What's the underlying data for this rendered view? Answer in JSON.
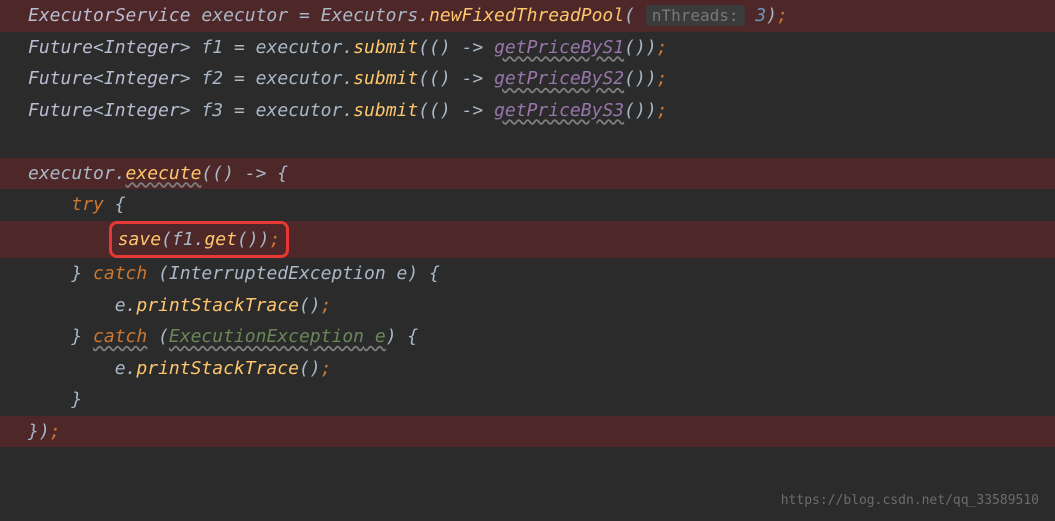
{
  "code": {
    "line1": {
      "type": "ExecutorService",
      "var": "executor",
      "eq": "=",
      "class": "Executors",
      "dot": ".",
      "method": "newFixedThreadPool",
      "open": "(",
      "hint": "nThreads:",
      "num": "3",
      "close": ")",
      "semi": ";"
    },
    "line2": {
      "type": "Future",
      "generic_open": "<",
      "generic_type": "Integer",
      "generic_close": ">",
      "var": "f1",
      "eq": "=",
      "obj": "executor",
      "dot": ".",
      "method": "submit",
      "args": "(() -> ",
      "call": "getPriceByS1",
      "parens": "()",
      "close": ")",
      "semi": ";"
    },
    "line3": {
      "type": "Future",
      "generic_open": "<",
      "generic_type": "Integer",
      "generic_close": ">",
      "var": "f2",
      "eq": "=",
      "obj": "executor",
      "dot": ".",
      "method": "submit",
      "args": "(() -> ",
      "call": "getPriceByS2",
      "parens": "()",
      "close": ")",
      "semi": ";"
    },
    "line4": {
      "type": "Future",
      "generic_open": "<",
      "generic_type": "Integer",
      "generic_close": ">",
      "var": "f3",
      "eq": "=",
      "obj": "executor",
      "dot": ".",
      "method": "submit",
      "args": "(() -> ",
      "call": "getPriceByS3",
      "parens": "()",
      "close": ")",
      "semi": ";"
    },
    "line6": {
      "obj": "executor",
      "dot": ".",
      "method": "execute",
      "args": "(() -> {"
    },
    "line7": {
      "indent": "    ",
      "kw": "try",
      "brace": " {"
    },
    "line8": {
      "indent": "        ",
      "call": "save",
      "open": "(",
      "obj": "f1",
      "dot": ".",
      "method": "get",
      "parens": "()",
      "close": ")",
      "semi": ";"
    },
    "line9": {
      "indent": "    ",
      "brace": "} ",
      "kw": "catch",
      "open": " (",
      "type": "InterruptedException",
      "var": " e",
      "close": ") {"
    },
    "line10": {
      "indent": "        ",
      "obj": "e",
      "dot": ".",
      "method": "printStackTrace",
      "parens": "()",
      "semi": ";"
    },
    "line11": {
      "indent": "    ",
      "brace": "} ",
      "kw": "catch",
      "open": " (",
      "type": "ExecutionException",
      "var": " e",
      "close": ") {"
    },
    "line12": {
      "indent": "        ",
      "obj": "e",
      "dot": ".",
      "method": "printStackTrace",
      "parens": "()",
      "semi": ";"
    },
    "line13": {
      "indent": "    ",
      "brace": "}"
    },
    "line14": {
      "brace": "})",
      "semi": ";"
    }
  },
  "watermark": "https://blog.csdn.net/qq_33589510"
}
